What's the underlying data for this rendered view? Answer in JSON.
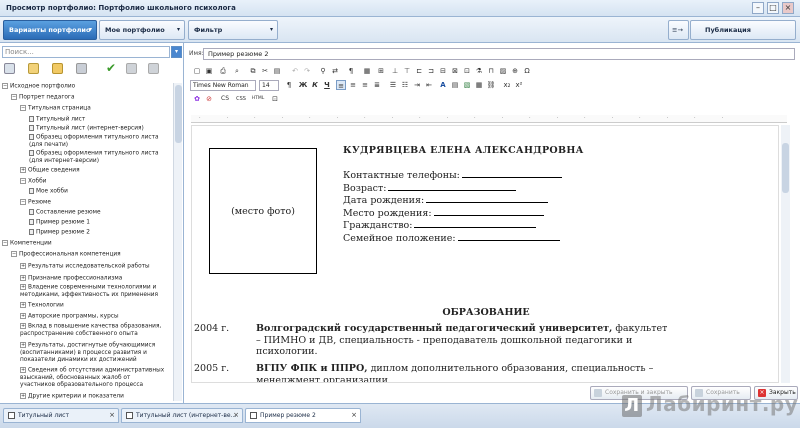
{
  "window": {
    "title": "Просмотр портфолио: Портфолио школьного психолога"
  },
  "topbar": {
    "variants_label": "Варианты портфолио",
    "my_portfolio_label": "Мое портфолио",
    "filter_label": "Фильтр",
    "publish_label": "Публикация портфолио"
  },
  "sidebar": {
    "search_placeholder": "Поиск...",
    "tree": [
      {
        "label": "Исходное портфолио",
        "depth": 0,
        "toggle": "−"
      },
      {
        "label": "Портрет педагога",
        "depth": 1,
        "toggle": "−"
      },
      {
        "label": "Титульная страница",
        "depth": 2,
        "toggle": "−"
      },
      {
        "label": "Титульный лист",
        "depth": 3,
        "toggle": ""
      },
      {
        "label": "Титульный лист (интернет-версия)",
        "depth": 3,
        "toggle": ""
      },
      {
        "label": "Образец оформления титульного листа (для печати)",
        "depth": 3,
        "toggle": ""
      },
      {
        "label": "Образец оформления титульного листа (для интернет-версии)",
        "depth": 3,
        "toggle": ""
      },
      {
        "label": "Общие сведения",
        "depth": 2,
        "toggle": "+"
      },
      {
        "label": "Хобби",
        "depth": 2,
        "toggle": "−"
      },
      {
        "label": "Мое хобби",
        "depth": 3,
        "toggle": ""
      },
      {
        "label": "Резюме",
        "depth": 2,
        "toggle": "−"
      },
      {
        "label": "Составление резюме",
        "depth": 3,
        "toggle": ""
      },
      {
        "label": "Пример резюме 1",
        "depth": 3,
        "toggle": ""
      },
      {
        "label": "Пример резюме 2",
        "depth": 3,
        "toggle": ""
      },
      {
        "label": "Компетенции",
        "depth": 0,
        "toggle": "−"
      },
      {
        "label": "Профессиональная компетенция",
        "depth": 1,
        "toggle": "−"
      },
      {
        "label": "Результаты исследовательской работы",
        "depth": 2,
        "toggle": "+"
      },
      {
        "label": "Признание профессионализма",
        "depth": 2,
        "toggle": "+"
      },
      {
        "label": "Владение современными технологиями и методиками, эффективность их применения",
        "depth": 2,
        "toggle": "+"
      },
      {
        "label": "Технологии",
        "depth": 2,
        "toggle": "+"
      },
      {
        "label": "Авторские программы, курсы",
        "depth": 2,
        "toggle": "+"
      },
      {
        "label": "Вклад в повышение качества образования, распространение собственного опыта",
        "depth": 2,
        "toggle": "+"
      },
      {
        "label": "Результаты, достигнутые обучающимися (воспитанниками) в процессе развития и показатели динамики их достижений",
        "depth": 2,
        "toggle": "+"
      },
      {
        "label": "Сведения об отсутствии административных взысканий, обоснованных жалоб от участников образовательного процесса",
        "depth": 2,
        "toggle": "+"
      },
      {
        "label": "Другие критерии и показатели",
        "depth": 2,
        "toggle": "+"
      }
    ]
  },
  "editor": {
    "name_label": "Имя:",
    "name_value": "Пример резюме 2",
    "font_family": "Times New Roman",
    "font_size": "14",
    "misc_labels": [
      "CS",
      "CSS",
      "HTML"
    ]
  },
  "document": {
    "photo_placeholder": "(место фото)",
    "person_name": "КУДРЯВЦЕВА ЕЛЕНА АЛЕКСАНДРОВНА",
    "fields": [
      "Контактные телефоны:",
      "Возраст:",
      "Дата рождения:",
      "Место рождения:",
      "Гражданство:",
      "Семейное положение:"
    ],
    "education_heading": "ОБРАЗОВАНИЕ",
    "education": [
      {
        "year": "2004 г.",
        "bold": "Волгоградский государственный педагогический университет,",
        "text": " факультет – ПИМНО и ДВ, специальность - преподаватель дошкольной педагогики и психологии."
      },
      {
        "year": "2005 г.",
        "bold": "ВГПУ ФПК и ППРО,",
        "text": " диплом дополнительного образования, специальность – менеджмент организации"
      }
    ]
  },
  "actions": {
    "save_close": "Сохранить и закрыть",
    "save": "Сохранить",
    "close": "Закрыть"
  },
  "bottom_tabs": [
    "Титульный лист",
    "Титульный лист (интернет-ве...",
    "Пример резюме 2"
  ],
  "watermark": {
    "letter": "Л",
    "text": "Лабиринт.ру"
  }
}
